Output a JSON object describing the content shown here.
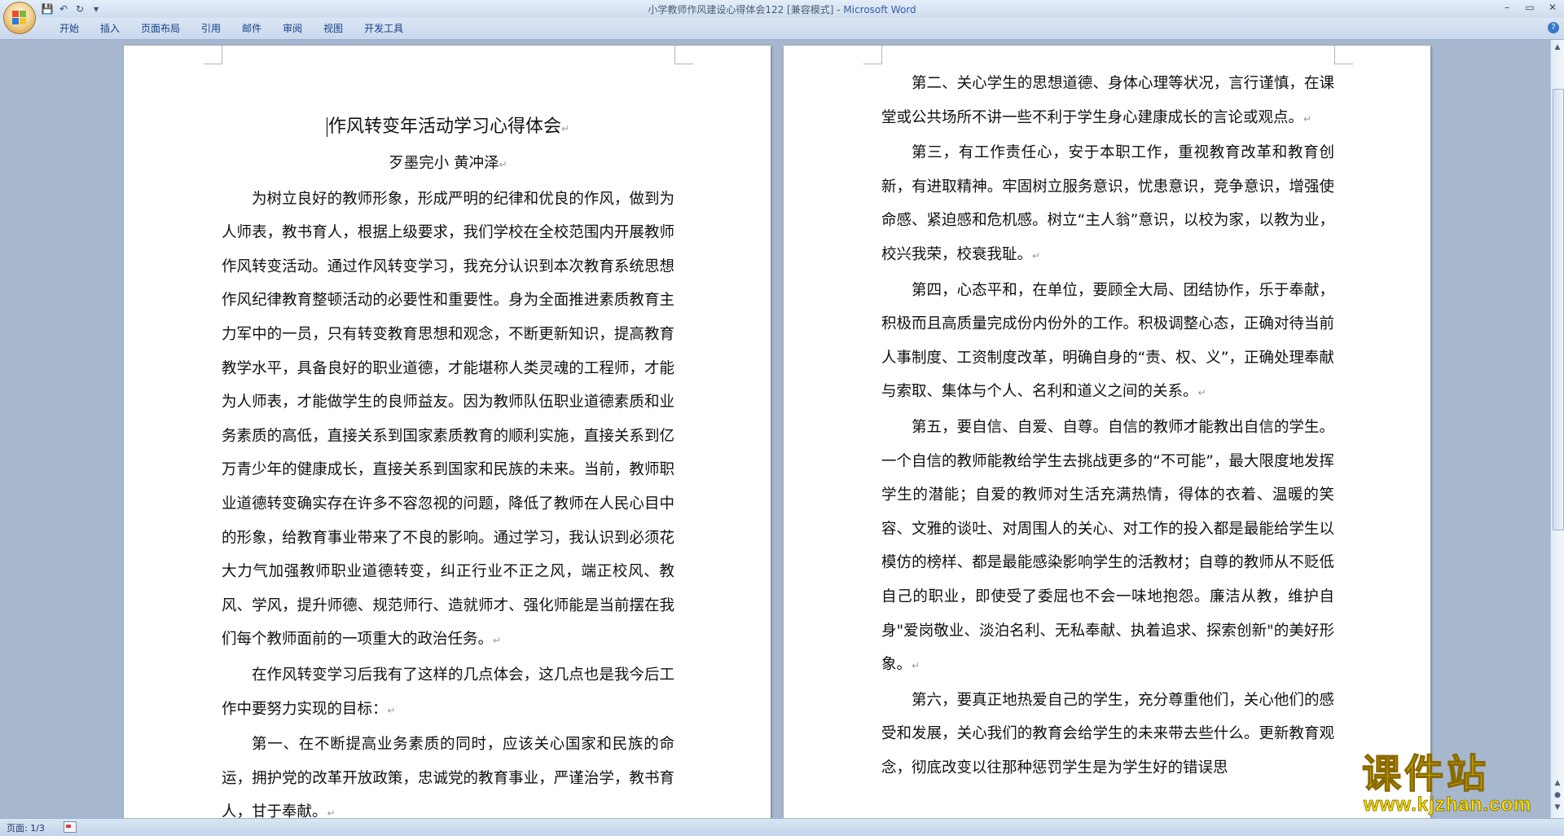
{
  "titlebar": {
    "title": "小学教师作风建设心得体会122 [兼容模式] - ",
    "app_name": "Microsoft Word",
    "qat": {
      "save": "💾",
      "undo": "↶",
      "redo": "↻",
      "customize": "▾"
    },
    "window": {
      "minimize": "–",
      "maximize": "▭",
      "close": "✕"
    }
  },
  "ribbon": {
    "tabs": [
      "开始",
      "插入",
      "页面布局",
      "引用",
      "邮件",
      "审阅",
      "视图",
      "开发工具"
    ],
    "help": "?"
  },
  "page1": {
    "title": "作风转变年活动学习心得体会",
    "author": "歹墨完小  黄冲泽",
    "paragraphs": [
      "为树立良好的教师形象，形成严明的纪律和优良的作风，做到为人师表，教书育人，根据上级要求，我们学校在全校范围内开展教师作风转变活动。通过作风转变学习，我充分认识到本次教育系统思想作风纪律教育整顿活动的必要性和重要性。身为全面推进素质教育主力军中的一员，只有转变教育思想和观念，不断更新知识，提高教育教学水平，具备良好的职业道德，才能堪称人类灵魂的工程师，才能为人师表，才能做学生的良师益友。因为教师队伍职业道德素质和业务素质的高低，直接关系到国家素质教育的顺利实施，直接关系到亿万青少年的健康成长，直接关系到国家和民族的未来。当前，教师职业道德转变确实存在许多不容忽视的问题，降低了教师在人民心目中的形象，给教育事业带来了不良的影响。通过学习，我认识到必须花大力气加强教师职业道德转变，纠正行业不正之风，端正校风、教风、学风，提升师德、规范师行、造就师才、强化师能是当前摆在我们每个教师面前的一项重大的政治任务。",
      "在作风转变学习后我有了这样的几点体会，这几点也是我今后工作中要努力实现的目标：",
      "第一、在不断提高业务素质的同时，应该关心国家和民族的命运，拥护党的改革开放政策，忠诚党的教育事业，严谨治学，教书育人，甘于奉献。"
    ]
  },
  "page2": {
    "paragraphs": [
      "第二、关心学生的思想道德、身体心理等状况，言行谨慎，在课堂或公共场所不讲一些不利于学生身心建康成长的言论或观点。",
      "第三，有工作责任心，安于本职工作，重视教育改革和教育创新，有进取精神。牢固树立服务意识，忧患意识，竞争意识，增强使命感、紧迫感和危机感。树立“主人翁”意识，以校为家，以教为业，校兴我荣，校衰我耻。",
      "第四，心态平和，在单位，要顾全大局、团结协作，乐于奉献，积极而且高质量完成份内份外的工作。积极调整心态，正确对待当前人事制度、工资制度改革，明确自身的“责、权、义”，正确处理奉献与索取、集体与个人、名利和道义之间的关系。",
      "第五，要自信、自爱、自尊。自信的教师才能教出自信的学生。一个自信的教师能教给学生去挑战更多的“不可能”，最大限度地发挥学生的潜能；自爱的教师对生活充满热情，得体的衣着、温暖的笑容、文雅的谈吐、对周围人的关心、对工作的投入都是最能给学生以模仿的榜样、都是最能感染影响学生的活教材；自尊的教师从不贬低自己的职业，即使受了委屈也不会一味地抱怨。廉洁从教，维护自身\"爱岗敬业、淡泊名利、无私奉献、执着追求、探索创新\"的美好形象。",
      "第六，要真正地热爱自己的学生，充分尊重他们，关心他们的感受和发展，关心我们的教育会给学生的未来带去些什么。更新教育观念，彻底改变以往那种惩罚学生是为学生好的错误思"
    ]
  },
  "paragraph_mark": "↵",
  "statusbar": {
    "page": "页面: 1/3"
  },
  "watermark": {
    "text": "课件站",
    "url": "www.kjzhan.com"
  }
}
